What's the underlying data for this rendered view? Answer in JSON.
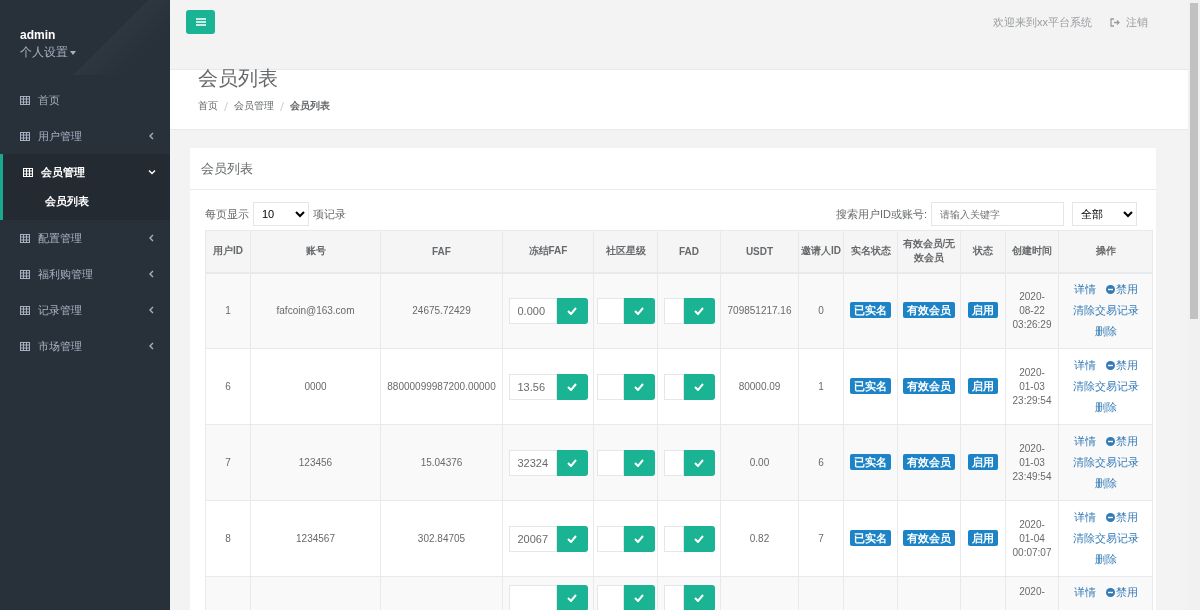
{
  "sidebar": {
    "user": "admin",
    "settings": "个人设置",
    "items": [
      {
        "label": "首页",
        "selected": false
      },
      {
        "label": "用户管理",
        "selected": false,
        "expanded": false
      },
      {
        "label": "会员管理",
        "selected": true,
        "expanded": true,
        "children": [
          {
            "label": "会员列表",
            "selected": true
          }
        ]
      },
      {
        "label": "配置管理",
        "selected": false,
        "expanded": false
      },
      {
        "label": "福利购管理",
        "selected": false,
        "expanded": false
      },
      {
        "label": "记录管理",
        "selected": false,
        "expanded": false
      },
      {
        "label": "市场管理",
        "selected": false,
        "expanded": false
      }
    ]
  },
  "topbar": {
    "welcome": "欢迎来到xx平台系统",
    "logout": "注销"
  },
  "header": {
    "title": "会员列表",
    "breadcrumb": [
      "首页",
      "会员管理",
      "会员列表"
    ]
  },
  "card": {
    "title": "会员列表",
    "per_page_label": "每页显示",
    "per_page": "10",
    "per_page_suffix": "项记录",
    "search_label": "搜索用户ID或账号:",
    "search_placeholder": "请输入关键字",
    "filter": "全部"
  },
  "table": {
    "columns": [
      "用户ID",
      "账号",
      "FAF",
      "冻结FAF",
      "社区星级",
      "FAD",
      "USDT",
      "邀请人ID",
      "实名状态",
      "有效会员/无效会员",
      "状态",
      "创建时间",
      "操作"
    ],
    "rows": [
      {
        "id": "1",
        "account": "fafcoin@163.com",
        "faf": "24675.72429",
        "frozen": "0.000",
        "usdt": "709851217.16",
        "inviter": "0",
        "realname": "已实名",
        "member": "有效会员",
        "status": "启用",
        "created": "2020-08-22 03:26:29",
        "actions": [
          "详情",
          "禁用",
          "清除交易记录",
          "删除"
        ]
      },
      {
        "id": "6",
        "account": "0000",
        "faf": "88000099987200.00000",
        "frozen": "13.56",
        "usdt": "80000.09",
        "inviter": "1",
        "realname": "已实名",
        "member": "有效会员",
        "status": "启用",
        "created": "2020-01-03 23:29:54",
        "actions": [
          "详情",
          "禁用",
          "清除交易记录",
          "删除"
        ]
      },
      {
        "id": "7",
        "account": "123456",
        "faf": "15.04376",
        "frozen": "32324",
        "usdt": "0.00",
        "inviter": "6",
        "realname": "已实名",
        "member": "有效会员",
        "status": "启用",
        "created": "2020-01-03 23:49:54",
        "actions": [
          "详情",
          "禁用",
          "清除交易记录",
          "删除"
        ]
      },
      {
        "id": "8",
        "account": "1234567",
        "faf": "302.84705",
        "frozen": "20067",
        "usdt": "0.82",
        "inviter": "7",
        "realname": "已实名",
        "member": "有效会员",
        "status": "启用",
        "created": "2020-01-04 00:07:07",
        "actions": [
          "详情",
          "禁用",
          "清除交易记录",
          "删除"
        ]
      },
      {
        "kind": "partial",
        "created": "2020-",
        "actions": [
          "详情",
          "禁用"
        ]
      }
    ]
  }
}
